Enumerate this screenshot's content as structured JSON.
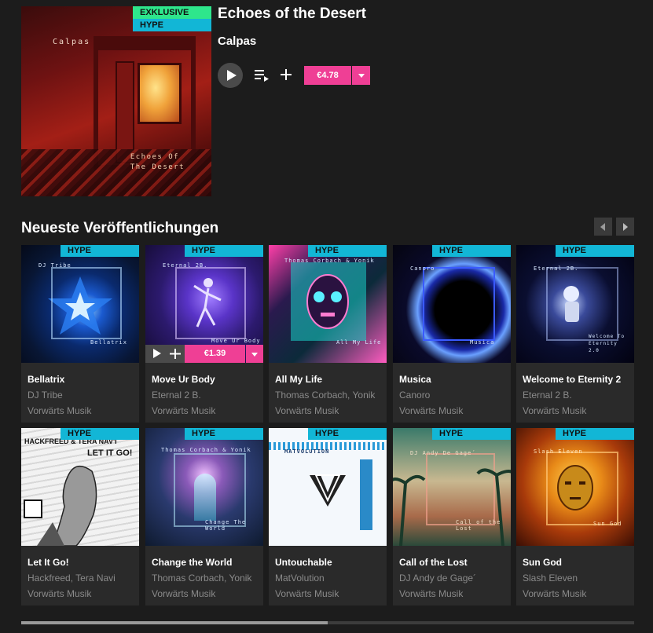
{
  "featured": {
    "badge_exclusive": "EXKLUSIVE",
    "badge_hype": "HYPE",
    "title": "Echoes of the Desert",
    "artist": "Calpas",
    "art_artist_text": "Calpas",
    "art_title_text": "Echoes Of\nThe Desert",
    "price": "€4.78"
  },
  "section": {
    "title": "Neueste Veröffentlichungen"
  },
  "releases": [
    {
      "badge": "HYPE",
      "title": "Bellatrix",
      "artist": "DJ Tribe",
      "label": "Vorwärts Musik",
      "art_top": "DJ Tribe",
      "art_bottom": "Bellatrix"
    },
    {
      "badge": "HYPE",
      "title": "Move Ur Body",
      "artist": "Eternal 2 B.",
      "label": "Vorwärts Musik",
      "art_top": "Eternal 2B.",
      "art_bottom": "Move Ur Body",
      "price": "€1.39"
    },
    {
      "badge": "HYPE",
      "title": "All My Life",
      "artist": "Thomas Corbach, Yonik",
      "label": "Vorwärts Musik",
      "art_top": "Thomas Corbach & Yonik",
      "art_bottom": "All My Life"
    },
    {
      "badge": "HYPE",
      "title": "Musica",
      "artist": "Canoro",
      "label": "Vorwärts Musik",
      "art_top": "Canoro",
      "art_bottom": "Musica"
    },
    {
      "badge": "HYPE",
      "title": "Welcome to Eternity 2",
      "artist": "Eternal 2 B.",
      "label": "Vorwärts Musik",
      "art_top": "Eternal 2B.",
      "art_bottom": "Welcome To Eternity 2.0"
    },
    {
      "badge": "HYPE",
      "title": "Let It Go!",
      "artist": "Hackfreed, Tera Navi",
      "label": "Vorwärts Musik",
      "art_top": "HACKFREED & TERA NAV'I",
      "art_bottom": "LET IT GO!"
    },
    {
      "badge": "HYPE",
      "title": "Change the World",
      "artist": "Thomas Corbach, Yonik",
      "label": "Vorwärts Musik",
      "art_top": "Thomas Corbach & Yonik",
      "art_bottom": "Change The World"
    },
    {
      "badge": "HYPE",
      "title": "Untouchable",
      "artist": "MatVolution",
      "label": "Vorwärts Musik",
      "art_top": "MATVOLUTION",
      "art_bottom": ""
    },
    {
      "badge": "HYPE",
      "title": "Call of the Lost",
      "artist": "DJ Andy de Gage´",
      "label": "Vorwärts Musik",
      "art_top": "DJ Andy De Gage´",
      "art_bottom": "Call of the Lost"
    },
    {
      "badge": "HYPE",
      "title": "Sun God",
      "artist": "Slash Eleven",
      "label": "Vorwärts Musik",
      "art_top": "Slash Eleven",
      "art_bottom": "Sun God"
    }
  ],
  "colors": {
    "background": "#1c1c1c",
    "card": "#2a2a2a",
    "hype_badge": "#12b6d6",
    "exclusive_badge": "#2ee68c",
    "price_pink": "#ef3f95"
  },
  "scroll": {
    "position_fraction": 0.5
  }
}
